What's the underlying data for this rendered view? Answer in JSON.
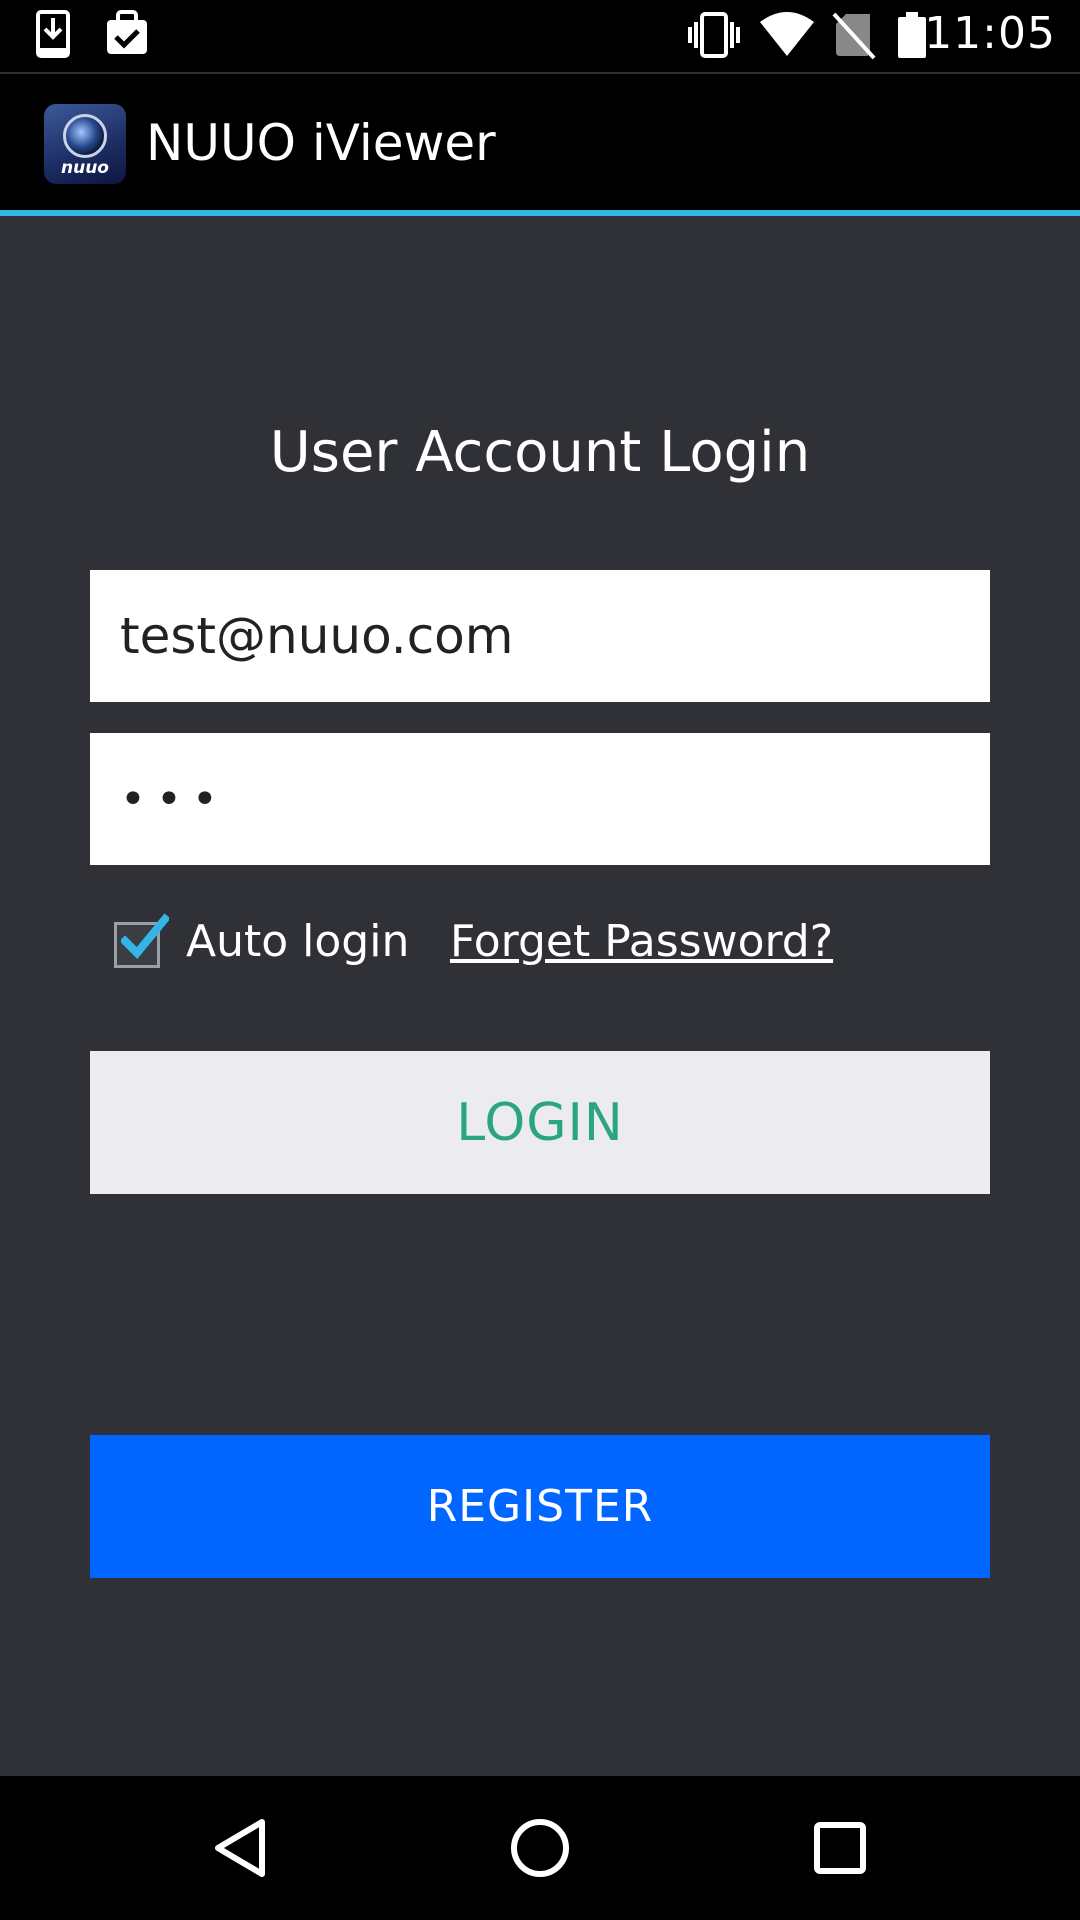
{
  "status_bar": {
    "time": "11:05",
    "icons": [
      "download-icon",
      "clipboard-check-icon",
      "vibrate-icon",
      "wifi-icon",
      "no-sim-icon",
      "battery-icon"
    ]
  },
  "action_bar": {
    "title": "NUUO iViewer",
    "app_icon_brand": "nuuo",
    "accent_color": "#33b5e5"
  },
  "login_form": {
    "heading": "User Account Login",
    "email_value": "test@nuuo.com",
    "password_value": "•••",
    "auto_login_label": "Auto login",
    "auto_login_checked": true,
    "forget_password_label": "Forget Password?",
    "login_label": "LOGIN",
    "login_text_color": "#2ba57f",
    "register_label": "REGISTER",
    "register_color": "#0066ff"
  },
  "nav_bar": {
    "icons": [
      "back-icon",
      "home-icon",
      "recents-icon"
    ]
  }
}
